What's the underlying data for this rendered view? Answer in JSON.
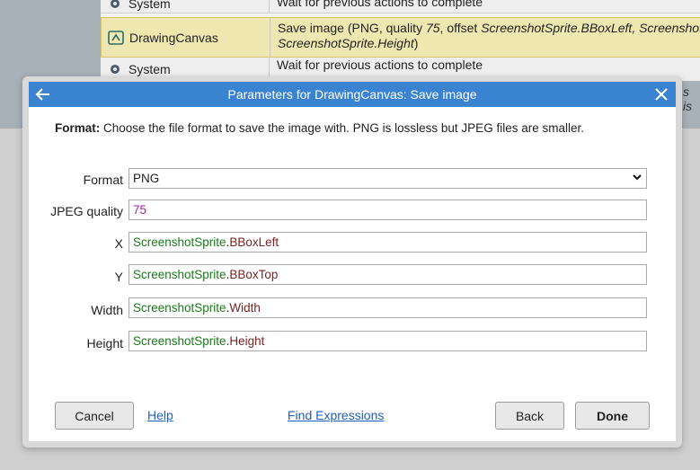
{
  "event_sheet": {
    "rows": [
      {
        "object": "System",
        "action": "Wait for previous actions to complete"
      },
      {
        "object": "DrawingCanvas",
        "action_line1_prefix": "Save image (PNG, quality ",
        "action_line1_quality": "75",
        "action_line1_mid": ", offset ",
        "action_line1_expr": "ScreenshotSprite.BBoxLeft, ScreenshotSp",
        "action_line2_expr": "ScreenshotSprite.Height",
        "action_line2_suffix": ")"
      },
      {
        "object": "System",
        "action": "Wait for previous actions to complete"
      }
    ],
    "cut_text": "s is"
  },
  "dialog": {
    "title": "Parameters for DrawingCanvas: Save image",
    "description_label": "Format:",
    "description_text": " Choose the file format to save the image with. PNG is lossless but JPEG files are smaller.",
    "fields": {
      "format": {
        "label": "Format",
        "value": "PNG"
      },
      "jpeg_quality": {
        "label": "JPEG quality",
        "value": "75"
      },
      "x": {
        "label": "X",
        "object": "ScreenshotSprite",
        "property": "BBoxLeft"
      },
      "y": {
        "label": "Y",
        "object": "ScreenshotSprite",
        "property": "BBoxTop"
      },
      "width": {
        "label": "Width",
        "object": "ScreenshotSprite",
        "property": "Width"
      },
      "height": {
        "label": "Height",
        "object": "ScreenshotSprite",
        "property": "Height"
      }
    },
    "buttons": {
      "cancel": "Cancel",
      "help": "Help",
      "find_expressions": "Find Expressions",
      "back": "Back",
      "done": "Done"
    }
  },
  "colors": {
    "titlebar": "#3a83d0",
    "object_expr": "#1a7a1a",
    "property_expr": "#7a2424",
    "number": "#a51ea5",
    "selected_row": "#efe7b0"
  }
}
